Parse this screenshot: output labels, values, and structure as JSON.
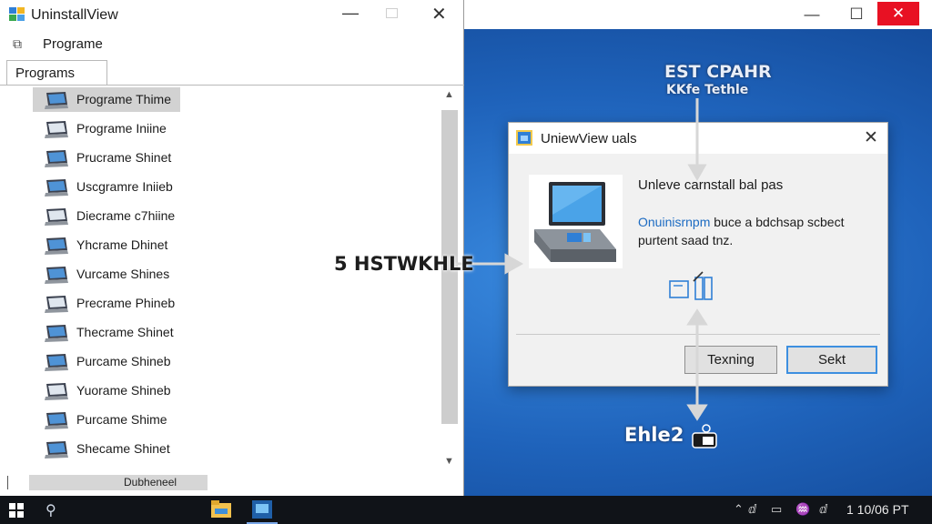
{
  "window": {
    "title": "UninstallView",
    "menu": {
      "label": "Programe"
    },
    "tab": {
      "label": "Programs"
    },
    "programs": [
      {
        "name": "Programe Thime",
        "selected": true
      },
      {
        "name": "Programe Iniine"
      },
      {
        "name": "Prucrame Shinet"
      },
      {
        "name": "Uscgramre Iniieb"
      },
      {
        "name": "Diecrame c7hiine"
      },
      {
        "name": "Yhcrame Dhinet"
      },
      {
        "name": "Vurcame Shines"
      },
      {
        "name": "Precrame Phineb"
      },
      {
        "name": "Thecrame Shinet"
      },
      {
        "name": "Purcame Shineb"
      },
      {
        "name": "Yuorame Shineb"
      },
      {
        "name": "Purcame Shime"
      },
      {
        "name": "Shecame Shinet"
      }
    ],
    "hscroll_label": "Dubheneel"
  },
  "dialog": {
    "title": "UniewView uals",
    "heading": "Unleve carnstall bal pas",
    "message_link": "Onuinisrnpm",
    "message_rest": " buce a bdchsap scbect purtent saad tnz.",
    "buttons": {
      "secondary": "Texning",
      "primary": "Sekt"
    }
  },
  "annotations": {
    "top_line1": "EST CPAHR",
    "top_line2": "KKfe Tethle",
    "left": "5 HSTWKHLE",
    "bottom": "Ehle2"
  },
  "taskbar": {
    "clock": "1 10/06 PT"
  },
  "colors": {
    "desktop": "#1f63bb",
    "taskbar": "#101318",
    "close": "#e81123",
    "accent": "#3d8fe0",
    "link": "#1c6bc2"
  }
}
